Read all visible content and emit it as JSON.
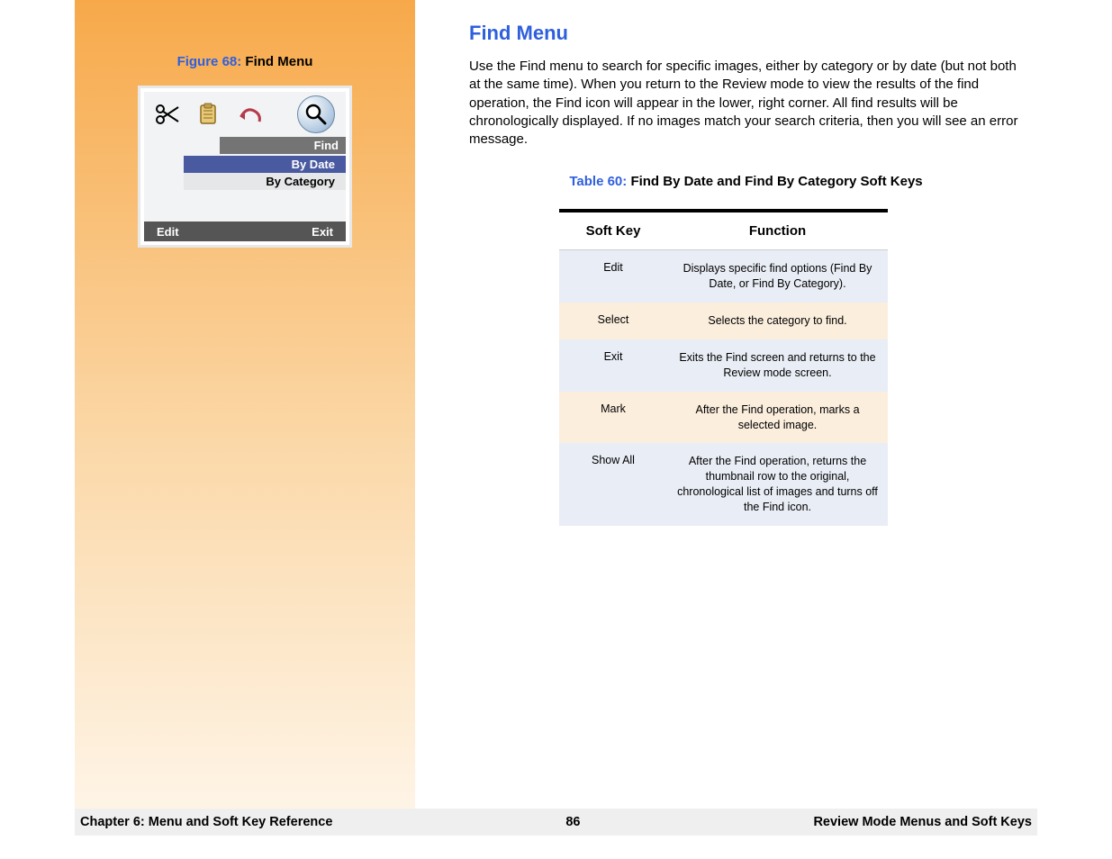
{
  "figure": {
    "label": "Figure 68:",
    "title": "Find Menu",
    "screen": {
      "tab_label": "Find",
      "menu_selected": "By Date",
      "menu_other": "By Category",
      "softkey_left": "Edit",
      "softkey_right": "Exit"
    }
  },
  "main": {
    "heading": "Find Menu",
    "paragraph": "Use the Find menu to search for specific images, either by category or by date (but not both at the same time). When you return to the Review mode to view the results of the find operation, the Find icon will appear in the lower, right corner. All find results will be chronologically displayed. If no images match your search criteria, then you will see an error message."
  },
  "table": {
    "label": "Table 60:",
    "title": "Find By Date and Find By Category Soft Keys",
    "headers": {
      "col1": "Soft Key",
      "col2": "Function"
    },
    "rows": [
      {
        "key": "Edit",
        "func": "Displays specific find options (Find By Date, or Find By Category)."
      },
      {
        "key": "Select",
        "func": "Selects the category to find."
      },
      {
        "key": "Exit",
        "func": "Exits the Find screen and returns to the Review mode screen."
      },
      {
        "key": "Mark",
        "func": "After the Find operation, marks a selected image."
      },
      {
        "key": "Show All",
        "func": "After the Find operation, returns the thumbnail row to the original, chronological list of images and turns off the Find icon."
      }
    ]
  },
  "footer": {
    "left": "Chapter 6: Menu and Soft Key Reference",
    "center": "86",
    "right": "Review Mode Menus and Soft Keys"
  }
}
